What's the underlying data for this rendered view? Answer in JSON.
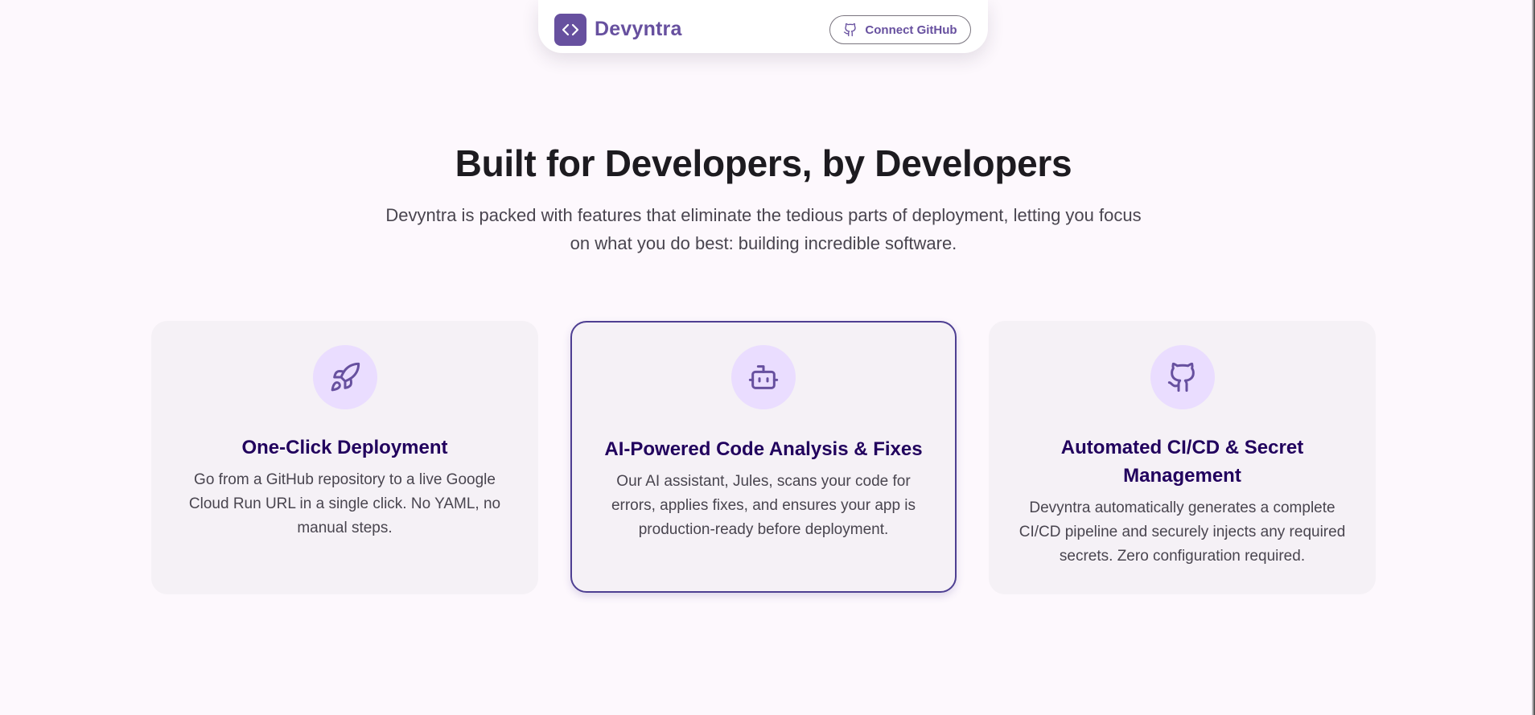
{
  "nav": {
    "logo_icon": "code-brackets-icon",
    "brand": "Devyntra",
    "connect_label": "Connect GitHub",
    "connect_icon": "github-icon"
  },
  "hero": {
    "title": "Built for Developers, by Developers",
    "subtitle": "Devyntra is packed with features that eliminate the tedious parts of deployment, letting you focus on what you do best: building incredible software."
  },
  "features": [
    {
      "icon": "rocket-icon",
      "title": "One-Click Deployment",
      "description": "Go from a GitHub repository to a live Google Cloud Run URL in a single click. No YAML, no manual steps."
    },
    {
      "icon": "robot-icon",
      "title": "AI-Powered Code Analysis & Fixes",
      "description": "Our AI assistant, Jules, scans your code for errors, applies fixes, and ensures your app is production-ready before deployment."
    },
    {
      "icon": "github-icon",
      "title": "Automated CI/CD & Secret Management",
      "description": "Devyntra automatically generates a complete CI/CD pipeline and securely injects any required secrets. Zero configuration required."
    }
  ],
  "colors": {
    "primary": "#67509f",
    "card_title": "#21005d",
    "icon_bg": "#eaddff",
    "card_bg": "#f5f1f6",
    "page_bg": "#fdf8fd",
    "highlight_border": "#4e3f92"
  }
}
